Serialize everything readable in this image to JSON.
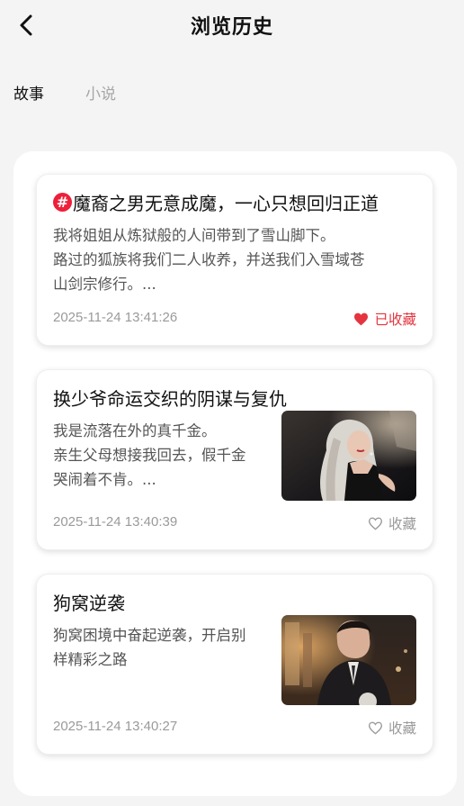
{
  "header": {
    "title": "浏览历史",
    "back_icon": "chevron-left-icon"
  },
  "tabs": [
    {
      "label": "故事",
      "active": true
    },
    {
      "label": "小说",
      "active": false
    }
  ],
  "colors": {
    "accent": "#e4353f",
    "badge": "#ee1f3a",
    "muted": "#9a9a9a"
  },
  "cards": [
    {
      "title": "魔裔之男无意成魔，一心只想回归正道",
      "badge": "#",
      "desc_lines": [
        "我将姐姐从炼狱般的人间带到了雪山脚下。",
        "路过的狐族将我们二人收养，并送我们入雪域苍",
        "山剑宗修行。..."
      ],
      "date": "2025-11-24 13:41:26",
      "fav_label": "已收藏",
      "favorited": true
    },
    {
      "title": "换少爷命运交织的阴谋与复仇",
      "desc_lines": [
        "我是流落在外的真千金。",
        "亲生父母想接我回去，假千金",
        "哭闹着不肯。..."
      ],
      "date": "2025-11-24 13:40:39",
      "fav_label": "收藏",
      "favorited": false,
      "thumbnail": "woman-in-car-image"
    },
    {
      "title": "狗窝逆袭",
      "desc_lines": [
        "狗窝困境中奋起逆袭，开启别",
        "样精彩之路"
      ],
      "date": "2025-11-24 13:40:27",
      "fav_label": "收藏",
      "favorited": false,
      "thumbnail": "man-in-suit-image"
    }
  ]
}
